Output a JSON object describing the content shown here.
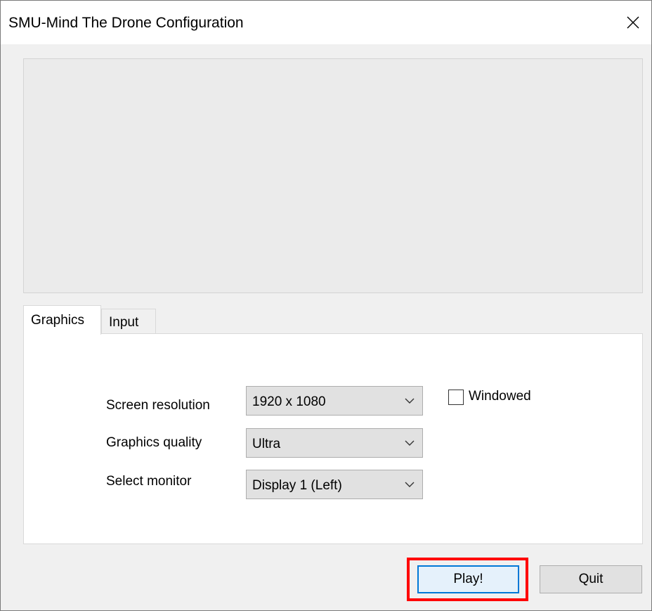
{
  "window": {
    "title": "SMU-Mind The Drone Configuration",
    "close_icon": "close-icon"
  },
  "tabs": [
    {
      "label": "Graphics",
      "active": true
    },
    {
      "label": "Input",
      "active": false
    }
  ],
  "graphics": {
    "screen_resolution_label": "Screen resolution",
    "screen_resolution_value": "1920 x 1080",
    "graphics_quality_label": "Graphics quality",
    "graphics_quality_value": "Ultra",
    "select_monitor_label": "Select monitor",
    "select_monitor_value": "Display 1 (Left)",
    "windowed_label": "Windowed",
    "windowed_checked": false
  },
  "buttons": {
    "play_label": "Play!",
    "quit_label": "Quit"
  },
  "colors": {
    "focus_accent": "#0078d7",
    "highlight": "#ff0000"
  }
}
